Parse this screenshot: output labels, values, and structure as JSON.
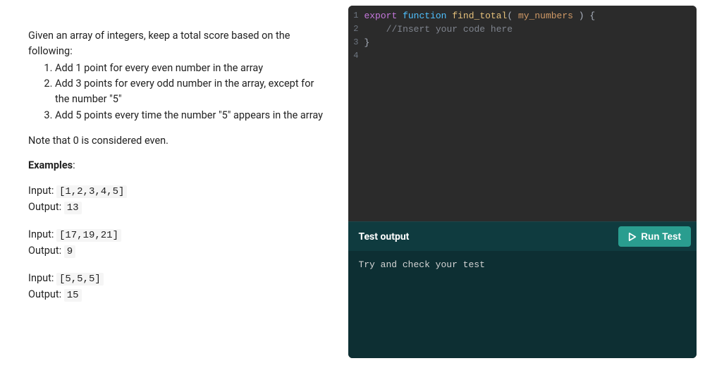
{
  "problem": {
    "intro": "Given an array of integers, keep a total score based on the following:",
    "rules": [
      "Add 1 point for every even number in the array",
      "Add 3 points for every odd number in the array, except for the number \"5\"",
      "Add 5 points every time the number \"5\" appears in the array"
    ],
    "note": "Note that 0 is considered even.",
    "examples_label": "Examples",
    "input_label": "Input:",
    "output_label": "Output:",
    "examples": [
      {
        "input": "[1,2,3,4,5]",
        "output": "13"
      },
      {
        "input": "[17,19,21]",
        "output": "9"
      },
      {
        "input": "[5,5,5]",
        "output": "15"
      }
    ]
  },
  "editor": {
    "lines": [
      {
        "num": "1",
        "tokens": [
          {
            "t": "export",
            "c": "tok-keyword"
          },
          {
            "t": " ",
            "c": "tok-plain"
          },
          {
            "t": "function",
            "c": "tok-keyword2"
          },
          {
            "t": " ",
            "c": "tok-plain"
          },
          {
            "t": "find_total",
            "c": "tok-func"
          },
          {
            "t": "(",
            "c": "tok-punct"
          },
          {
            "t": " my_numbers ",
            "c": "tok-param"
          },
          {
            "t": ")",
            "c": "tok-punct"
          },
          {
            "t": " ",
            "c": "tok-plain"
          },
          {
            "t": "{",
            "c": "tok-punct"
          }
        ]
      },
      {
        "num": "2",
        "tokens": [
          {
            "t": "    ",
            "c": "tok-plain"
          },
          {
            "t": "//Insert your code here",
            "c": "tok-comment"
          }
        ]
      },
      {
        "num": "3",
        "tokens": [
          {
            "t": "}",
            "c": "tok-punct"
          }
        ]
      },
      {
        "num": "4",
        "tokens": []
      }
    ]
  },
  "output": {
    "title": "Test output",
    "run_label": "Run Test",
    "body": "Try and check your test"
  }
}
